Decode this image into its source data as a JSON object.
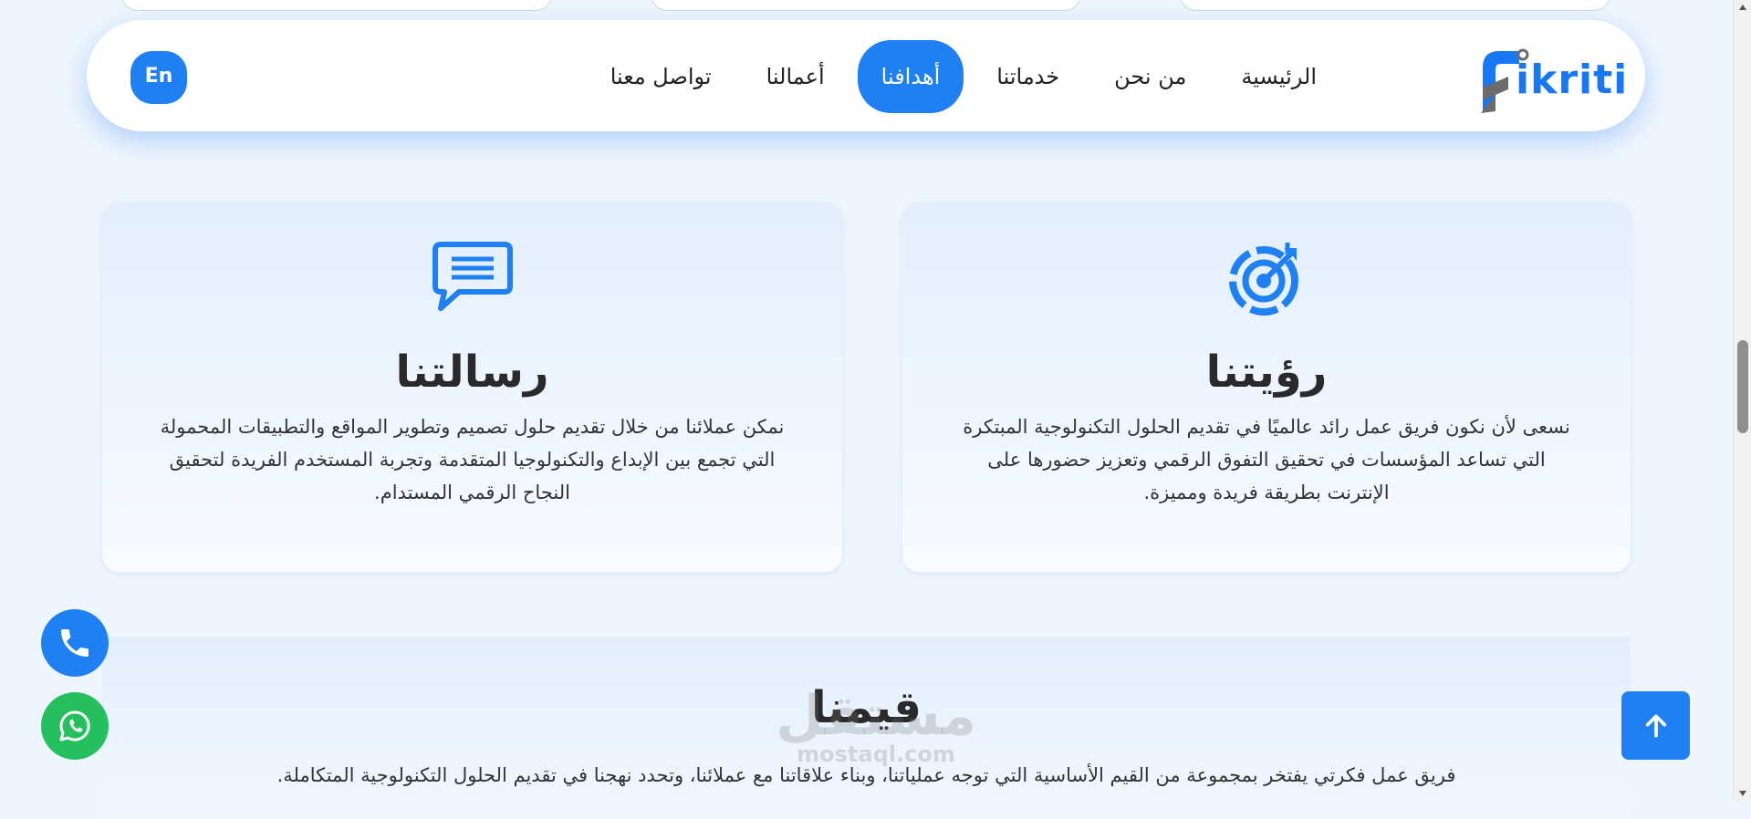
{
  "brand": {
    "logo_text": "ikriti",
    "accent": "#1e80f2"
  },
  "nav": {
    "items": [
      {
        "label": "الرئيسية",
        "active": false
      },
      {
        "label": "من نحن",
        "active": false
      },
      {
        "label": "خدماتنا",
        "active": false
      },
      {
        "label": "أهدافنا",
        "active": true
      },
      {
        "label": "أعمالنا",
        "active": false
      },
      {
        "label": "تواصل معنا",
        "active": false
      }
    ],
    "lang_label": "En"
  },
  "vision": {
    "icon": "target-icon",
    "title": "رؤيتنا",
    "text": "نسعى لأن نكون فريق عمل رائد عالميًا في تقديم الحلول التكنولوجية المبتكرة التي تساعد المؤسسات في تحقيق التفوق الرقمي وتعزيز حضورها على الإنترنت بطريقة فريدة ومميزة."
  },
  "mission": {
    "icon": "message-icon",
    "title": "رسالتنا",
    "text": "نمكن عملائنا من خلال تقديم حلول تصميم وتطوير المواقع والتطبيقات المحمولة التي تجمع بين الإبداع والتكنولوجيا المتقدمة وتجربة المستخدم الفريدة لتحقيق النجاح الرقمي المستدام."
  },
  "values": {
    "title": "قيمنا",
    "text": "فريق عمل فكرتي يفتخر بمجموعة من القيم الأساسية التي توجه عملياتنا، وبناء علاقاتنا مع عملائنا، وتحدد نهجنا في تقديم الحلول التكنولوجية المتكاملة."
  },
  "watermark": {
    "main": "مستقل",
    "sub": "mostaql.com"
  },
  "floating": {
    "phone_icon": "phone-icon",
    "whatsapp_icon": "whatsapp-icon",
    "scroll_icon": "arrow-up-icon",
    "whatsapp_color": "#25c05e"
  }
}
